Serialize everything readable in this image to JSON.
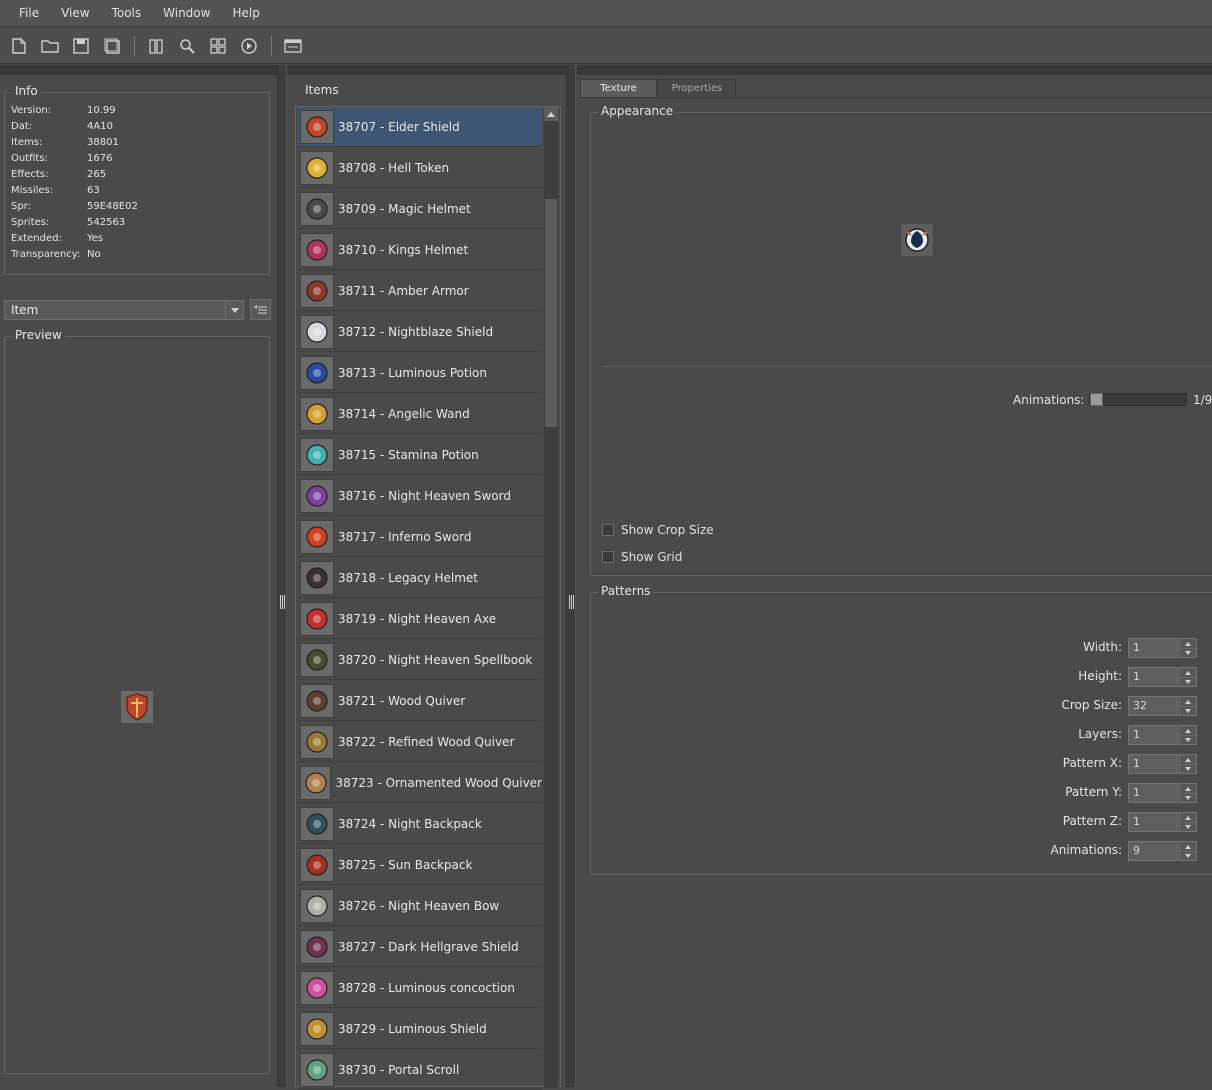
{
  "menu": [
    "File",
    "View",
    "Tools",
    "Window",
    "Help"
  ],
  "toolbar_icons": [
    "new-file-icon",
    "open-folder-icon",
    "save-icon",
    "save-as-icon",
    "compile-icon",
    "search-icon",
    "sprite-grid-icon",
    "play-animation-icon",
    "log-window-icon"
  ],
  "info": {
    "title": "Info",
    "rows": [
      {
        "key": "Version:",
        "value": "10.99"
      },
      {
        "key": "Dat:",
        "value": "4A10"
      },
      {
        "key": "Items:",
        "value": "38801"
      },
      {
        "key": "Outfits:",
        "value": "1676"
      },
      {
        "key": "Effects:",
        "value": "265"
      },
      {
        "key": "Missiles:",
        "value": "63"
      },
      {
        "key": "Spr:",
        "value": "59E48E02"
      },
      {
        "key": "Sprites:",
        "value": "542563"
      },
      {
        "key": "Extended:",
        "value": "Yes"
      },
      {
        "key": "Transparency:",
        "value": "No"
      }
    ]
  },
  "category_select": {
    "value": "Item"
  },
  "preview": {
    "title": "Preview"
  },
  "items": {
    "title": "Items",
    "list": [
      {
        "label": "38707 - Elder Shield",
        "color": "#c0452a",
        "selected": true
      },
      {
        "label": "38708 - Hell Token",
        "color": "#e0b030"
      },
      {
        "label": "38709 - Magic Helmet",
        "color": "#4a4a4a"
      },
      {
        "label": "38710 - Kings Helmet",
        "color": "#b03060"
      },
      {
        "label": "38711 - Amber Armor",
        "color": "#8a3a2a"
      },
      {
        "label": "38712 - Nightblaze Shield",
        "color": "#d8d8e0"
      },
      {
        "label": "38713 - Luminous Potion",
        "color": "#2a4aa0"
      },
      {
        "label": "38714 - Angelic Wand",
        "color": "#d0a030"
      },
      {
        "label": "38715 - Stamina Potion",
        "color": "#40b0b0"
      },
      {
        "label": "38716 - Night Heaven Sword",
        "color": "#8040a0"
      },
      {
        "label": "38717 - Inferno Sword",
        "color": "#d04020"
      },
      {
        "label": "38718 - Legacy Helmet",
        "color": "#3a3030"
      },
      {
        "label": "38719 - Night Heaven Axe",
        "color": "#c03030"
      },
      {
        "label": "38720 - Night Heaven Spellbook",
        "color": "#4a4a30"
      },
      {
        "label": "38721 - Wood Quiver",
        "color": "#5a4030"
      },
      {
        "label": "38722 - Refined Wood Quiver",
        "color": "#9a7a30"
      },
      {
        "label": "38723 - Ornamented Wood Quiver",
        "color": "#b08050"
      },
      {
        "label": "38724 - Night Backpack",
        "color": "#305060"
      },
      {
        "label": "38725 - Sun Backpack",
        "color": "#a03020"
      },
      {
        "label": "38726 - Night Heaven Bow",
        "color": "#b0b0a8"
      },
      {
        "label": "38727 - Dark Hellgrave Shield",
        "color": "#703050"
      },
      {
        "label": "38728 - Luminous concoction",
        "color": "#d050a0"
      },
      {
        "label": "38729 - Luminous Shield",
        "color": "#c09030"
      },
      {
        "label": "38730 - Portal Scroll",
        "color": "#60a080"
      }
    ]
  },
  "tabs": [
    "Texture",
    "Properties"
  ],
  "appearance": {
    "title": "Appearance",
    "animations_label": "Animations:",
    "animations_value": "1/9",
    "animation_frame": 1,
    "animation_total": 9,
    "show_crop_size": "Show Crop Size",
    "show_grid": "Show Grid"
  },
  "patterns": {
    "title": "Patterns",
    "fields": [
      {
        "label": "Width:",
        "value": "1"
      },
      {
        "label": "Height:",
        "value": "1"
      },
      {
        "label": "Crop Size:",
        "value": "32"
      },
      {
        "label": "Layers:",
        "value": "1"
      },
      {
        "label": "Pattern X:",
        "value": "1"
      },
      {
        "label": "Pattern Y:",
        "value": "1"
      },
      {
        "label": "Pattern Z:",
        "value": "1"
      },
      {
        "label": "Animations:",
        "value": "9"
      }
    ]
  }
}
